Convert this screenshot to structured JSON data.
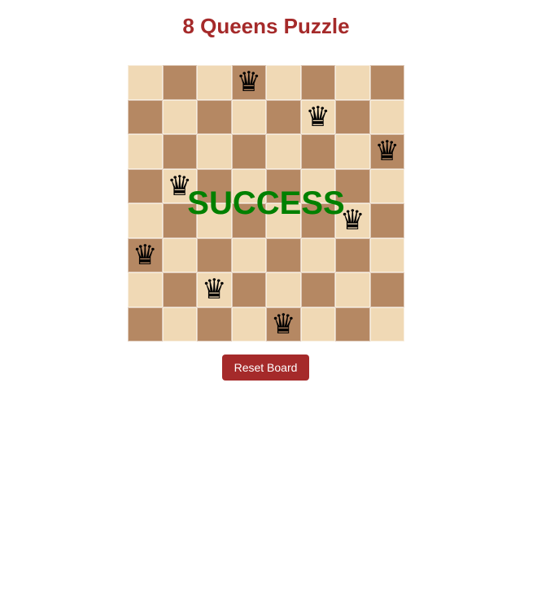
{
  "title": "8 Queens Puzzle",
  "status_text": "SUCCESS",
  "reset_label": "Reset Board",
  "queen_icon": "queen-icon",
  "queen_glyph": "♛",
  "board": {
    "size": 8,
    "queens": [
      {
        "row": 0,
        "col": 3
      },
      {
        "row": 1,
        "col": 5
      },
      {
        "row": 2,
        "col": 7
      },
      {
        "row": 3,
        "col": 1
      },
      {
        "row": 4,
        "col": 6
      },
      {
        "row": 5,
        "col": 0
      },
      {
        "row": 6,
        "col": 2
      },
      {
        "row": 7,
        "col": 4
      }
    ]
  },
  "colors": {
    "title": "#a52a2a",
    "light_square": "#f0d9b5",
    "dark_square": "#b58863",
    "success": "#008000",
    "button_bg": "#a52a2a",
    "button_text": "#ffffff",
    "queen": "#000000"
  }
}
